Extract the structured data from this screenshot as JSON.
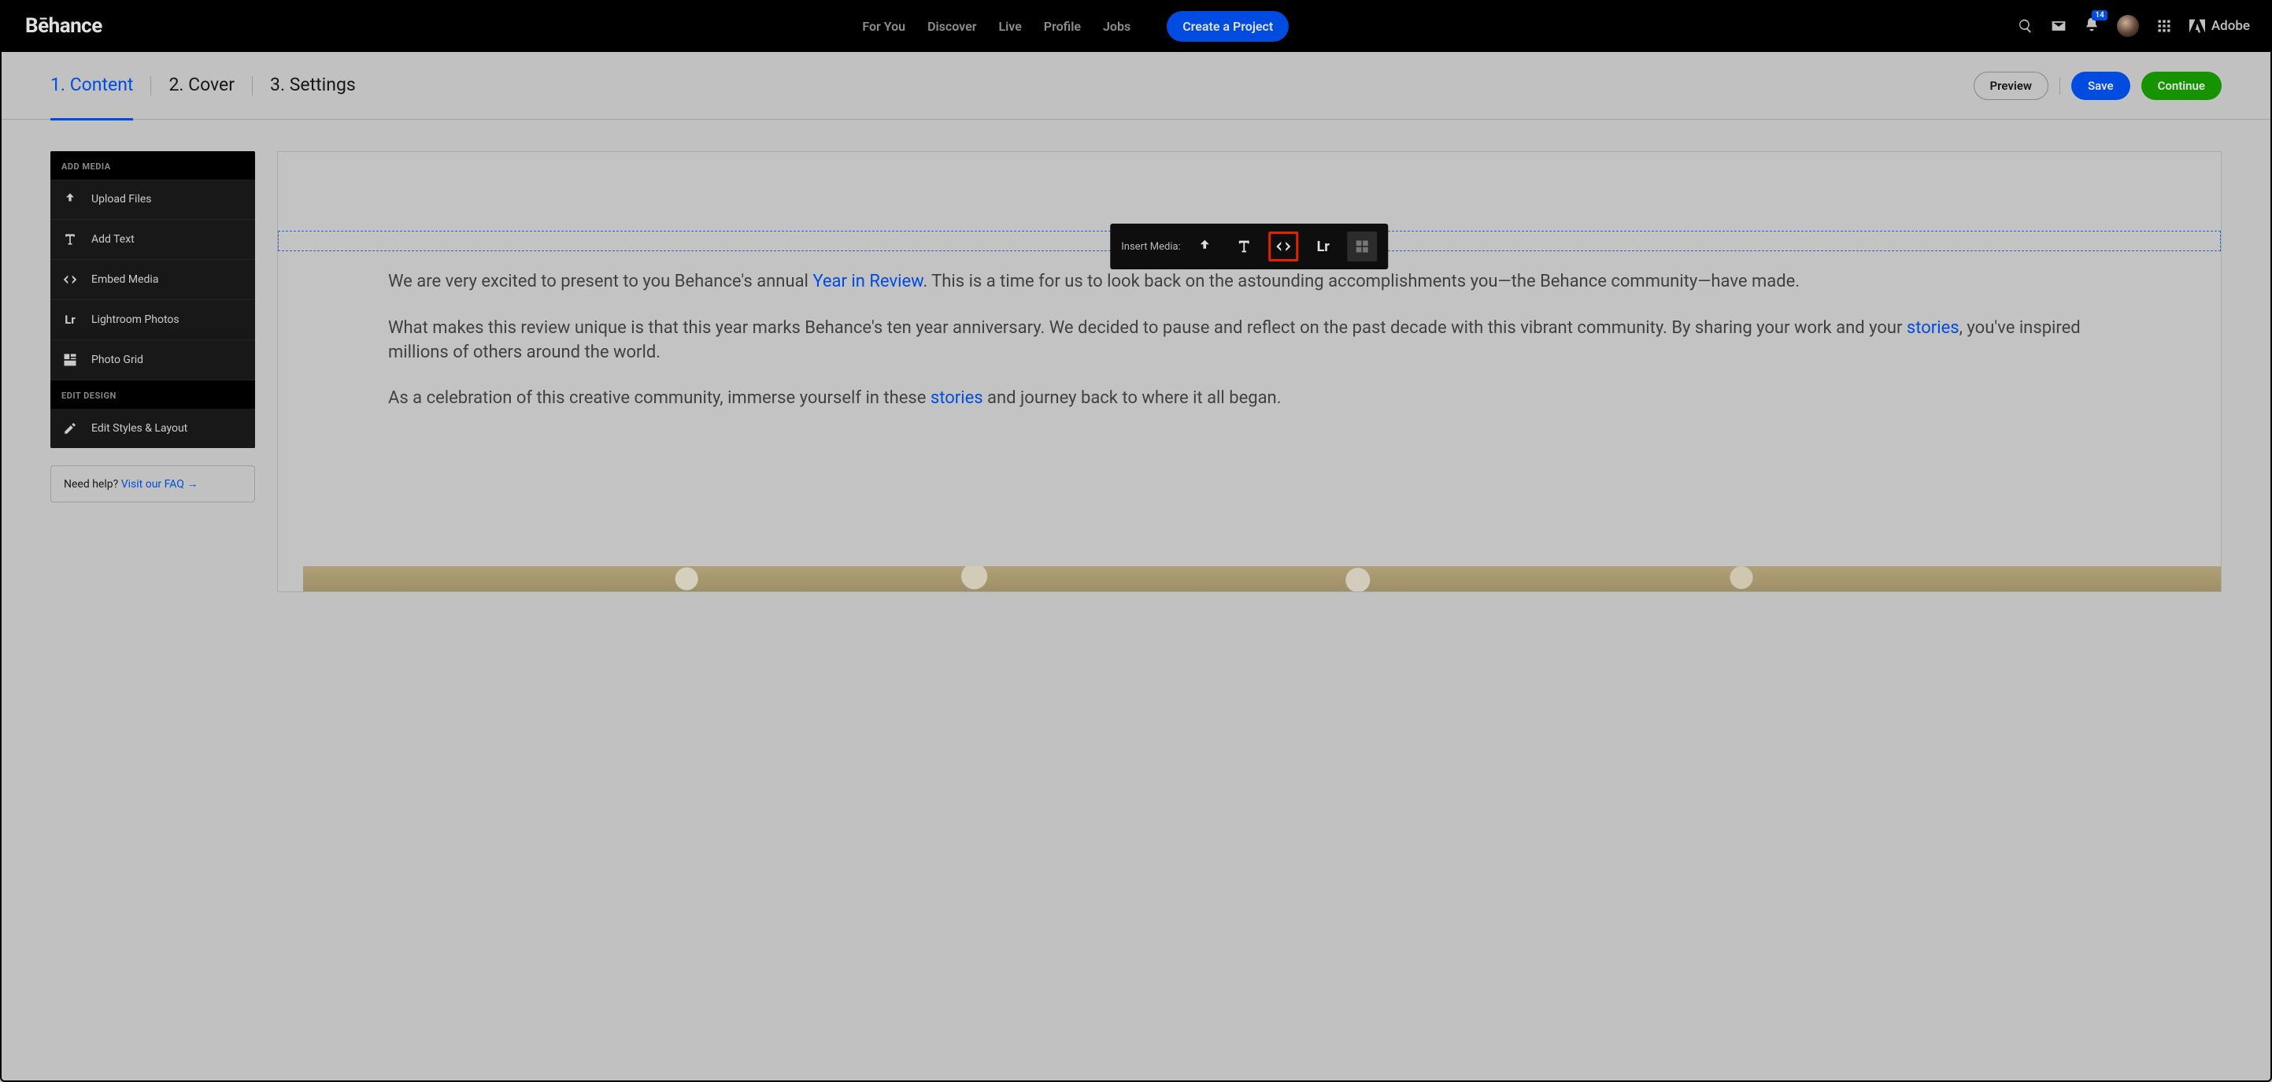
{
  "topnav": {
    "logo": "Bēhance",
    "links": [
      "For You",
      "Discover",
      "Live",
      "Profile",
      "Jobs"
    ],
    "create_label": "Create a Project",
    "notif_count": "14",
    "adobe_label": "Adobe"
  },
  "subheader": {
    "steps": [
      "1. Content",
      "2. Cover",
      "3. Settings"
    ],
    "active_step_index": 0,
    "preview_label": "Preview",
    "save_label": "Save",
    "continue_label": "Continue"
  },
  "sidebar": {
    "add_media_header": "ADD MEDIA",
    "items": [
      {
        "icon": "upload",
        "label": "Upload Files"
      },
      {
        "icon": "text",
        "label": "Add Text"
      },
      {
        "icon": "embed",
        "label": "Embed Media"
      },
      {
        "icon": "lr",
        "label": "Lightroom Photos"
      },
      {
        "icon": "grid",
        "label": "Photo Grid"
      }
    ],
    "edit_header": "EDIT DESIGN",
    "edit_item": {
      "icon": "pencil",
      "label": "Edit Styles & Layout"
    }
  },
  "help": {
    "prefix": "Need help? ",
    "link": "Visit our FAQ →"
  },
  "insert_bar": {
    "label": "Insert Media:",
    "highlighted": "embed"
  },
  "article": {
    "p1_a": "We are very excited to present to you Behance's annual ",
    "p1_link": "Year in Review",
    "p1_b": ". This is a time for us to look back on the astounding accomplishments you—the Behance community—have made.",
    "p2_a": "What makes this review unique is that this year marks Behance's ten year anniversary. We decided to pause and reflect on the past decade with this vibrant community. By sharing your work and your ",
    "p2_link": "stories",
    "p2_b": ", you've inspired millions of others around the world.",
    "p3_a": "As a celebration of this creative community, immerse yourself in these ",
    "p3_link": "stories",
    "p3_b": " and journey back to where it all began."
  }
}
